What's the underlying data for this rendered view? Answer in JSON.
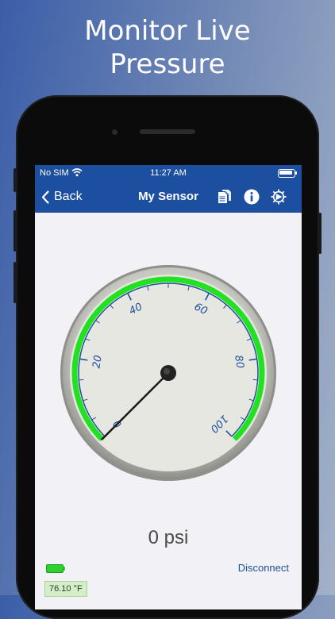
{
  "headline": {
    "line1": "Monitor Live",
    "line2": "Pressure"
  },
  "statusbar": {
    "carrier": "No SIM",
    "time": "11:27 AM"
  },
  "navbar": {
    "back_label": "Back",
    "title": "My Sensor",
    "icons": [
      "copy-icon",
      "info-icon",
      "settings-icon"
    ]
  },
  "gauge": {
    "tick_labels": [
      "0",
      "20",
      "40",
      "60",
      "80",
      "100"
    ],
    "value": 0,
    "min": 0,
    "max": 100,
    "unit": "psi"
  },
  "reading": {
    "text": "0 psi"
  },
  "footer": {
    "disconnect_label": "Disconnect",
    "temperature": "76.10 °F",
    "battery_level": 1.0
  },
  "colors": {
    "nav": "#1c4fa0",
    "arc": "#22e022",
    "scale": "#1f4f9c",
    "dial": "#e6e6e1"
  }
}
